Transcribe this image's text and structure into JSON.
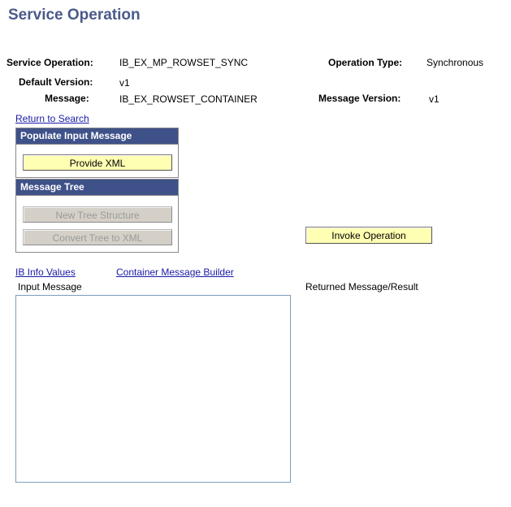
{
  "page": {
    "title": "Service Operation"
  },
  "details": {
    "service_operation_label": "Service Operation:",
    "service_operation_value": "IB_EX_MP_ROWSET_SYNC",
    "operation_type_label": "Operation Type:",
    "operation_type_value": "Synchronous",
    "default_version_label": "Default Version:",
    "default_version_value": "v1",
    "message_label": "Message:",
    "message_value": "IB_EX_ROWSET_CONTAINER",
    "message_version_label": "Message Version:",
    "message_version_value": "v1"
  },
  "links": {
    "return_to_search": "Return to Search",
    "ib_info_values": "IB Info Values",
    "container_message_builder": "Container Message Builder"
  },
  "populate_group": {
    "header": "Populate Input Message",
    "provide_xml": "Provide XML"
  },
  "tree_group": {
    "header": "Message Tree",
    "new_tree_structure": "New Tree Structure",
    "convert_tree_to_xml": "Convert Tree to XML"
  },
  "actions": {
    "invoke_operation": "Invoke Operation"
  },
  "io": {
    "input_message_label": "Input Message",
    "input_message_value": "",
    "returned_message_label": "Returned Message/Result"
  }
}
